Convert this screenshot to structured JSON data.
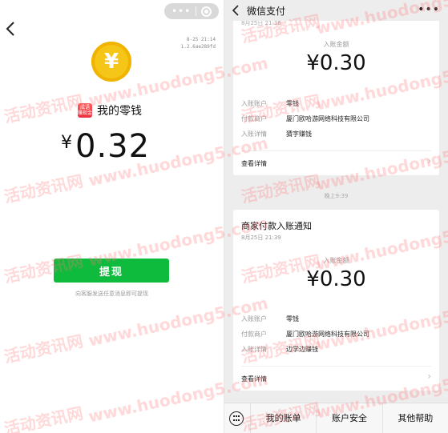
{
  "left": {
    "meta_time": "8-25 21:14",
    "meta_version": "1.2.6ae289fd",
    "coin_symbol": "¥",
    "wallet_badge": "成语 赚现金",
    "wallet_title": "我的零钱",
    "currency": "¥",
    "balance": "0.32",
    "withdraw_label": "提现",
    "hint": "向客服发送任意消息即可提现"
  },
  "right": {
    "title": "微信支付",
    "more": "•••",
    "card1": {
      "date_top": "8月25日 21:36",
      "amount_label": "入账金额",
      "amount": "¥0.30",
      "rows": [
        {
          "k": "入账账户",
          "v": "零钱"
        },
        {
          "k": "付款商户",
          "v": "厦门欧哈游网络科技有限公司"
        },
        {
          "k": "入账详情",
          "v": "猜字赚钱"
        }
      ],
      "view_detail": "查看详情"
    },
    "timestamp": "晚上9:39",
    "card2": {
      "heading": "商家付款入账通知",
      "date": "8月25日 21:39",
      "amount_label": "入账金额",
      "amount": "¥0.30",
      "rows": [
        {
          "k": "入账账户",
          "v": "零钱"
        },
        {
          "k": "付款商户",
          "v": "厦门欧哈游网络科技有限公司"
        },
        {
          "k": "入账详情",
          "v": "边学边赚钱"
        }
      ],
      "view_detail": "查看详情"
    },
    "tabs": [
      "我的账单",
      "账户安全",
      "其他帮助"
    ]
  },
  "watermark": {
    "cn": "活动资讯网",
    "url": "www.huodong5.com"
  },
  "colors": {
    "green": "#0fbb3c",
    "coin": "#f5c518",
    "watermark": "#ff7878"
  }
}
